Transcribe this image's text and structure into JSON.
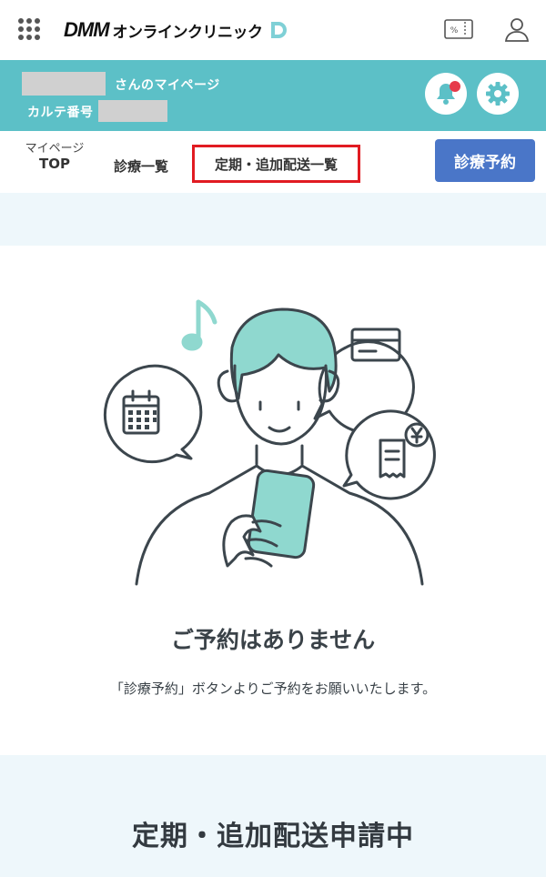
{
  "header": {
    "brand": "DMM",
    "service_name": "オンラインクリニック",
    "coupon_label": "%"
  },
  "banner": {
    "mypage_suffix": "さんのマイページ",
    "karte_label": "カルテ番号"
  },
  "tabs": {
    "top_line1": "マイページ",
    "top_line2": "TOP",
    "history": "診療一覧",
    "regular": "定期・追加配送一覧",
    "reserve_button": "診療予約"
  },
  "empty_state": {
    "title": "ご予約はありません",
    "description": "「診療予約」ボタンよりご予約をお願いいたします。"
  },
  "section": {
    "title": "定期・追加配送申請中"
  },
  "colors": {
    "banner": "#5cc0c7",
    "reserve_button": "#4a76c8",
    "highlight_border": "#e11b22",
    "pale_background": "#eef7fb",
    "notification_dot": "#e63b4b"
  }
}
